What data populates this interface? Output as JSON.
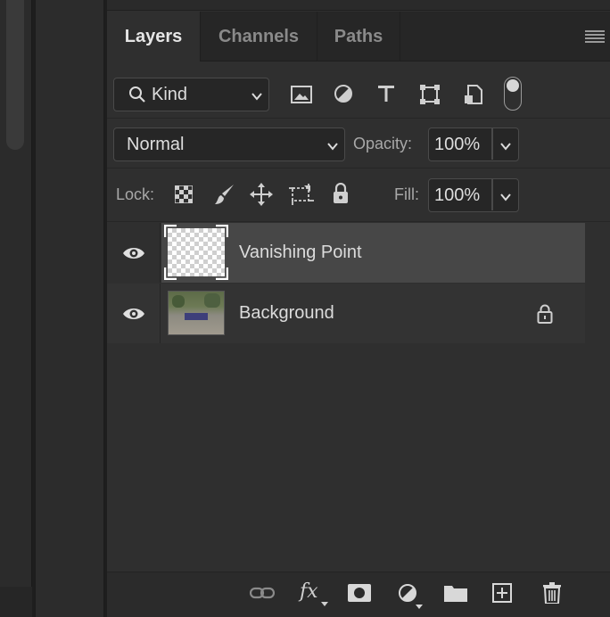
{
  "tabs": [
    {
      "label": "Layers"
    },
    {
      "label": "Channels"
    },
    {
      "label": "Paths"
    }
  ],
  "filter": {
    "kind_label": "Kind"
  },
  "blend": {
    "mode": "Normal",
    "opacity_label": "Opacity:",
    "opacity_value": "100%"
  },
  "lock": {
    "label": "Lock:",
    "fill_label": "Fill:",
    "fill_value": "100%"
  },
  "layers": [
    {
      "name": "Vanishing Point",
      "selected": true,
      "locked": false
    },
    {
      "name": "Background",
      "selected": false,
      "locked": true
    }
  ],
  "footer": {
    "fx_label": "fx"
  },
  "colors": {
    "selected_row": "#474747",
    "panel_bg": "#2f2f2f"
  }
}
